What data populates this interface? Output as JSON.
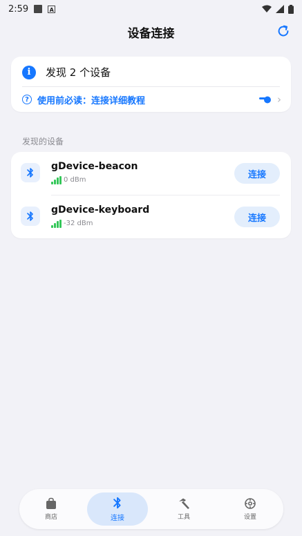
{
  "status_bar": {
    "time": "2:59"
  },
  "header": {
    "title": "设备连接",
    "refresh_icon": "refresh-icon"
  },
  "info_card": {
    "found_text": "发现 2 个设备",
    "tutorial_text": "使用前必读：连接详细教程"
  },
  "section_label": "发现的设备",
  "devices": [
    {
      "name": "gDevice-beacon",
      "rssi": "0 dBm",
      "connect_label": "连接"
    },
    {
      "name": "gDevice-keyboard",
      "rssi": "-32 dBm",
      "connect_label": "连接"
    }
  ],
  "tabs": [
    {
      "label": "商店",
      "icon": "shop-bag-icon"
    },
    {
      "label": "连接",
      "icon": "bluetooth-icon",
      "active": true
    },
    {
      "label": "工具",
      "icon": "hammer-icon"
    },
    {
      "label": "设置",
      "icon": "gear-icon"
    }
  ],
  "colors": {
    "accent": "#1677ff",
    "signal": "#34c759",
    "background": "#f2f2f7"
  }
}
